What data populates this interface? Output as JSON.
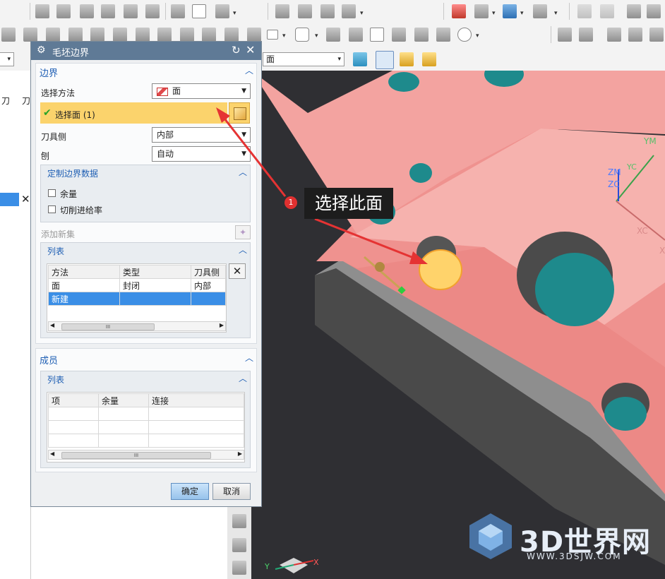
{
  "toolbar": {
    "combo1_arrow": "▾",
    "combo2_value": "面",
    "combo2_arrow": "▾",
    "left_combo_arrow": "▾"
  },
  "left_panel": {
    "col1": "刀",
    "col2": "刀"
  },
  "dialog": {
    "title": "毛坯边界",
    "boundary_section": {
      "heading": "边界",
      "select_method_label": "选择方法",
      "select_method_value": "面",
      "selected_face_label": "选择面 (1)",
      "tool_side_label": "刀具侧",
      "tool_side_value": "内部",
      "plane_label": "刨",
      "plane_value": "自动",
      "custom_panel": {
        "heading": "定制边界数据",
        "allowance_label": "余量",
        "feedrate_label": "切削进给率"
      },
      "add_new_set_label": "添加新集",
      "list_panel": {
        "heading": "列表",
        "columns": [
          "方法",
          "类型",
          "刀具侧"
        ],
        "rows": [
          [
            "面",
            "封闭",
            "内部"
          ],
          [
            "新建",
            "",
            ""
          ]
        ]
      }
    },
    "members_section": {
      "heading": "成员",
      "list_heading": "列表",
      "columns": [
        "项",
        "余量",
        "连接"
      ]
    },
    "ok_label": "确定",
    "cancel_label": "取消"
  },
  "annotation": {
    "number": "1",
    "text": "选择此面"
  },
  "viewport_axes": {
    "ym": "YM",
    "zm": "ZM",
    "zc": "ZC",
    "yc": "YC",
    "xc": "XC",
    "x": "X",
    "y": "Y",
    "x2": "X"
  },
  "watermark": {
    "brand": "3D世界网",
    "url": "WWW.3DSJW.COM"
  },
  "colors": {
    "part_face": "#ee8f8c",
    "hole_fill": "#1e8a8c",
    "selected_face": "#ffd36b",
    "title_bar": "#5f7a96",
    "highlight_row": "#fbd36c",
    "arrow_red": "#e53333"
  }
}
